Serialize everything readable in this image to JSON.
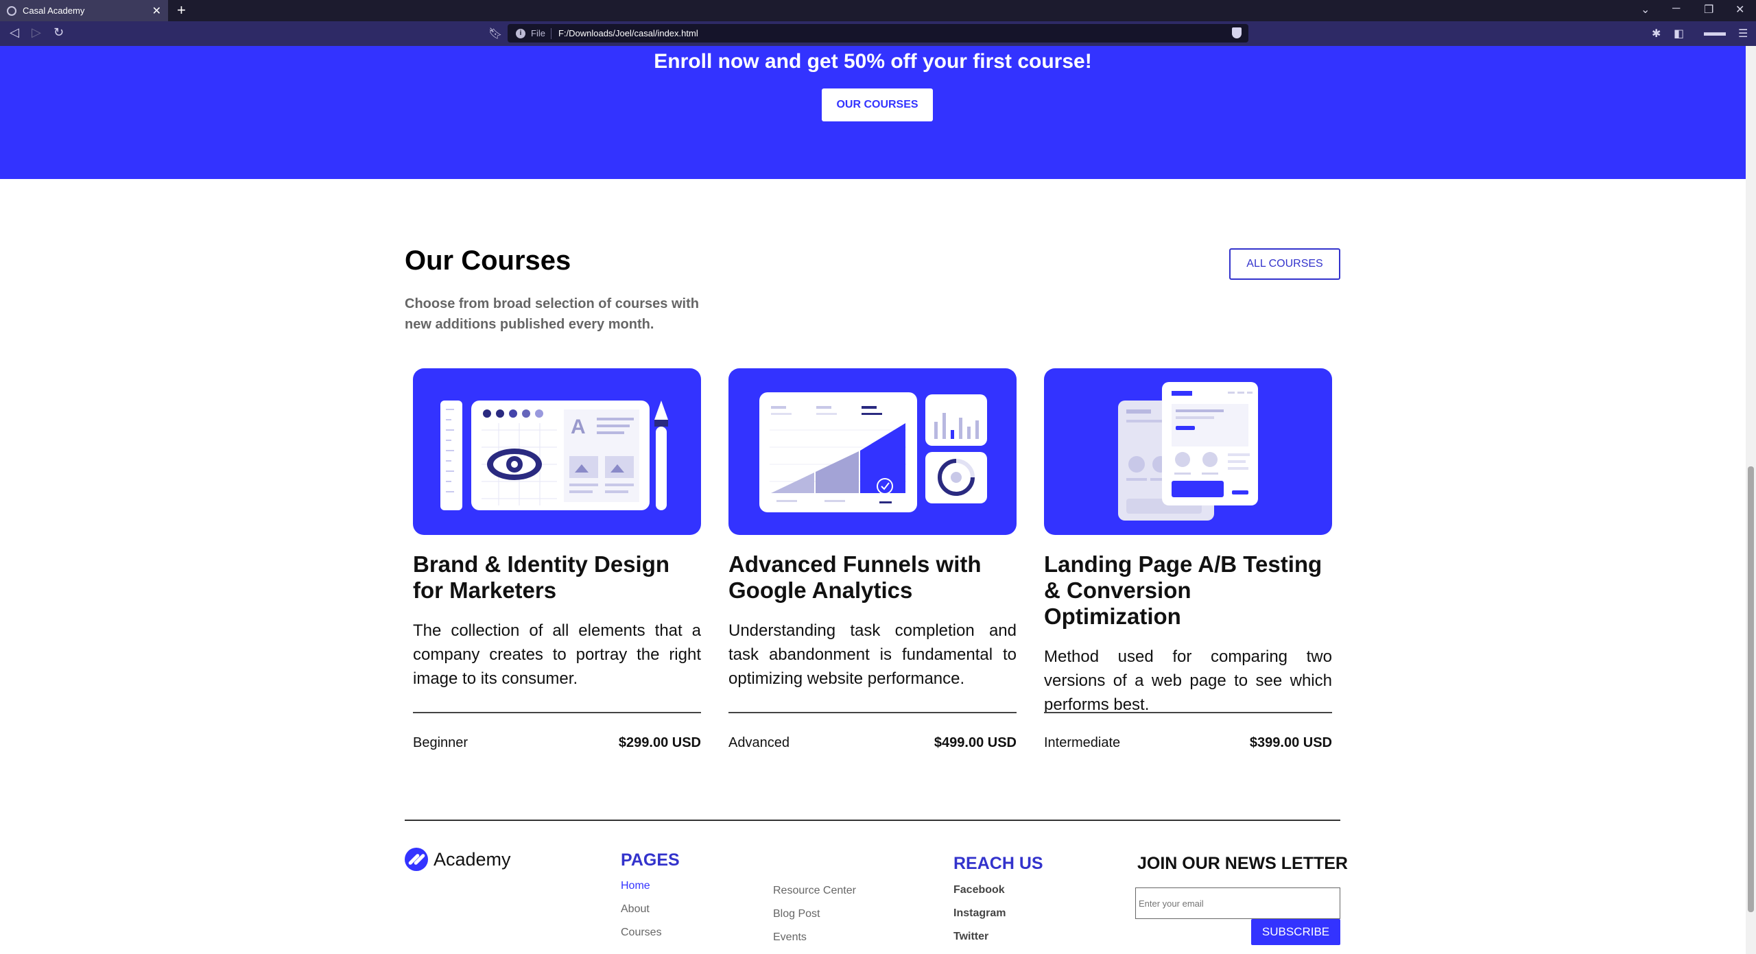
{
  "browser": {
    "tab_title": "Casal Academy",
    "tab_close": "✕",
    "new_tab": "+",
    "url_scheme": "File",
    "url": "F:/Downloads/Joel/casal/index.html"
  },
  "hero": {
    "headline": "Enroll now and get 50% off your first course!",
    "button_label": "OUR COURSES"
  },
  "courses": {
    "title": "Our Courses",
    "subtitle": "Choose from broad selection of courses with new additions published every month.",
    "all_button": "ALL COURSES",
    "items": [
      {
        "title": "Brand & Identity Design for Marketers",
        "description": "The collection of all elements that a company creates to portray the right image to its consumer.",
        "level": "Beginner",
        "price": "$299.00 USD"
      },
      {
        "title": "Advanced Funnels with Google Analytics",
        "description": "Understanding task completion and task abandonment is fundamental to optimizing website performance.",
        "level": "Advanced",
        "price": "$499.00 USD"
      },
      {
        "title": "Landing Page A/B Testing & Conversion Optimization",
        "description": "Method used for comparing two versions of a web page to see which performs best.",
        "level": "Intermediate",
        "price": "$399.00 USD"
      }
    ]
  },
  "footer": {
    "logo_text": "Academy",
    "pages_heading": "PAGES",
    "pages_links": [
      "Home",
      "About",
      "Courses"
    ],
    "resource_links": [
      "Resource Center",
      "Blog Post",
      "Events"
    ],
    "reach_heading": "REACH US",
    "reach_links": [
      "Facebook",
      "Instagram",
      "Twitter"
    ],
    "newsletter_heading": "JOIN OUR NEWS LETTER",
    "email_placeholder": "Enter your email",
    "subscribe_label": "SUBSCRIBE"
  },
  "colors": {
    "brand_blue": "#3333ff",
    "chrome_dark": "#1c1b2e",
    "chrome_bar": "#2e2a66"
  }
}
